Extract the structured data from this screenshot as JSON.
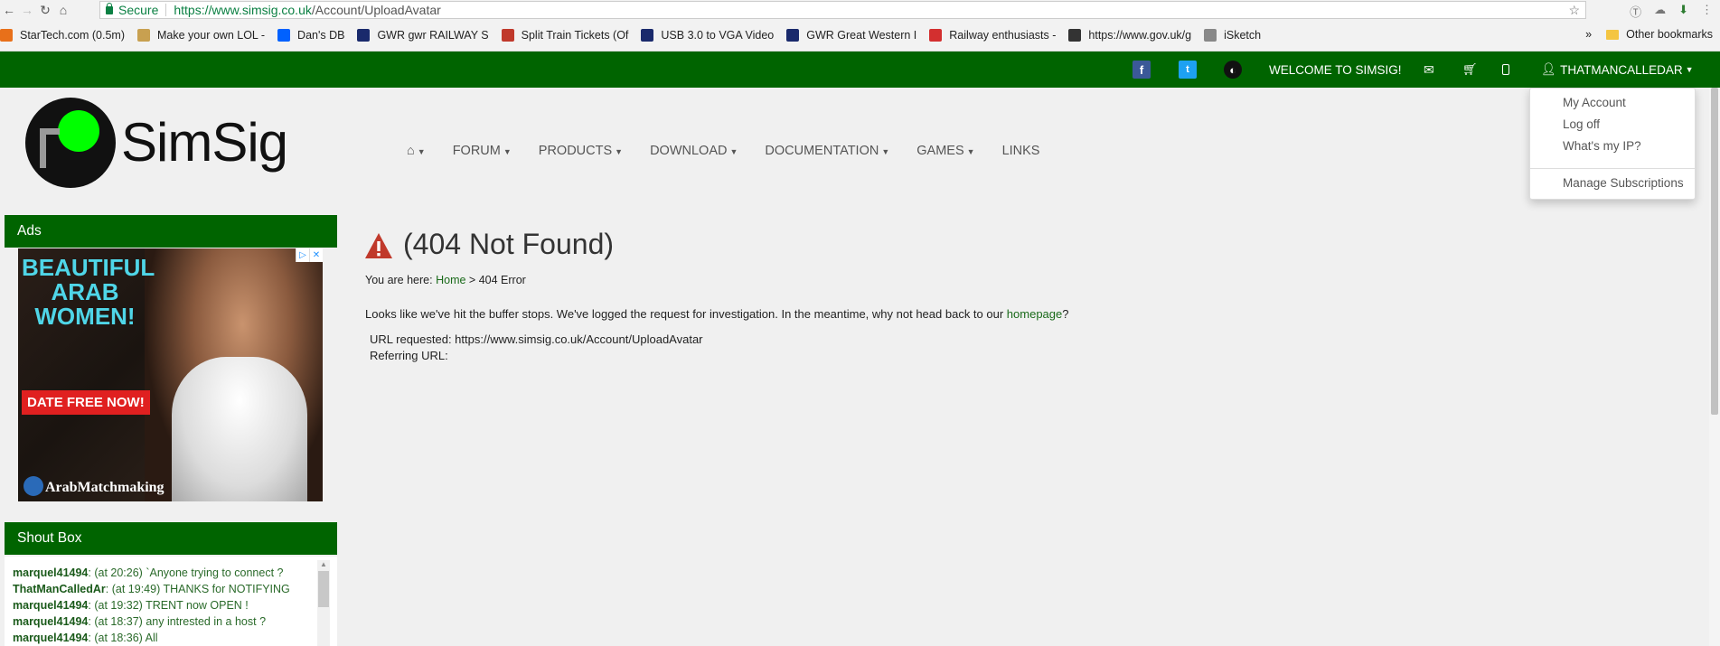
{
  "browser": {
    "secure_label": "Secure",
    "url_host": "https://www.simsig.co.uk",
    "url_path": "/Account/UploadAvatar"
  },
  "bookmarks": [
    {
      "label": "StarTech.com (0.5m)",
      "color": "#e8701a"
    },
    {
      "label": "Make your own LOL -",
      "color": "#c8a050"
    },
    {
      "label": "Dan's DB",
      "color": "#0061fe"
    },
    {
      "label": "GWR gwr RAILWAY S",
      "color": "#1a2a6c"
    },
    {
      "label": "Split Train Tickets (Of",
      "color": "#c0392b"
    },
    {
      "label": "USB 3.0 to VGA Video",
      "color": "#1a2a6c"
    },
    {
      "label": "GWR Great Western I",
      "color": "#1a2a6c"
    },
    {
      "label": "Railway enthusiasts -",
      "color": "#d32f2f"
    },
    {
      "label": "https://www.gov.uk/g",
      "color": "#333333"
    },
    {
      "label": "iSketch",
      "color": "#888888"
    }
  ],
  "bookmarks_overflow": "»",
  "other_bookmarks": "Other bookmarks",
  "topbar": {
    "welcome": "WELCOME TO SIMSIG!",
    "username": "THATMANCALLEDAR"
  },
  "logo_text": "SimSig",
  "nav": [
    {
      "label": "FORUM",
      "caret": true
    },
    {
      "label": "PRODUCTS",
      "caret": true
    },
    {
      "label": "DOWNLOAD",
      "caret": true
    },
    {
      "label": "DOCUMENTATION",
      "caret": true
    },
    {
      "label": "GAMES",
      "caret": true
    },
    {
      "label": "LINKS",
      "caret": false
    }
  ],
  "dropdown": {
    "my_account": "My Account",
    "log_off": "Log off",
    "whats_my_ip": "What's my IP?",
    "manage_subscriptions": "Manage Subscriptions"
  },
  "sidebar": {
    "ads_title": "Ads",
    "ad": {
      "headline": "BEAUTIFUL ARAB WOMEN!",
      "cta": "DATE FREE NOW!",
      "brand": "ArabMatchmaking"
    },
    "shoutbox_title": "Shout Box",
    "shouts": [
      {
        "user": "marquel41494",
        "text": ": (at 20:26) `Anyone trying to connect ?"
      },
      {
        "user": "ThatManCalledAr",
        "text": ": (at 19:49) THANKS for NOTIFYING"
      },
      {
        "user": "marquel41494",
        "text": ": (at 19:32) TRENT now OPEN !"
      },
      {
        "user": "marquel41494",
        "text": ": (at 18:37) any intrested in a host ?"
      },
      {
        "user": "marquel41494",
        "text": ": (at 18:36) All"
      }
    ]
  },
  "main": {
    "title": "(404 Not Found)",
    "breadcrumb_prefix": "You are here:",
    "breadcrumb_home": "Home",
    "breadcrumb_sep": ">",
    "breadcrumb_current": "404 Error",
    "message_before": "Looks like we've hit the buffer stops. We've logged the request for investigation. In the meantime, why not head back to our ",
    "message_link": "homepage",
    "message_after": "?",
    "url_requested": "URL requested: https://www.simsig.co.uk/Account/UploadAvatar",
    "referring_url": "Referring URL:"
  },
  "colors": {
    "brand_green": "#006400",
    "logo_green": "#00ff00",
    "warning_red": "#c0392b"
  }
}
